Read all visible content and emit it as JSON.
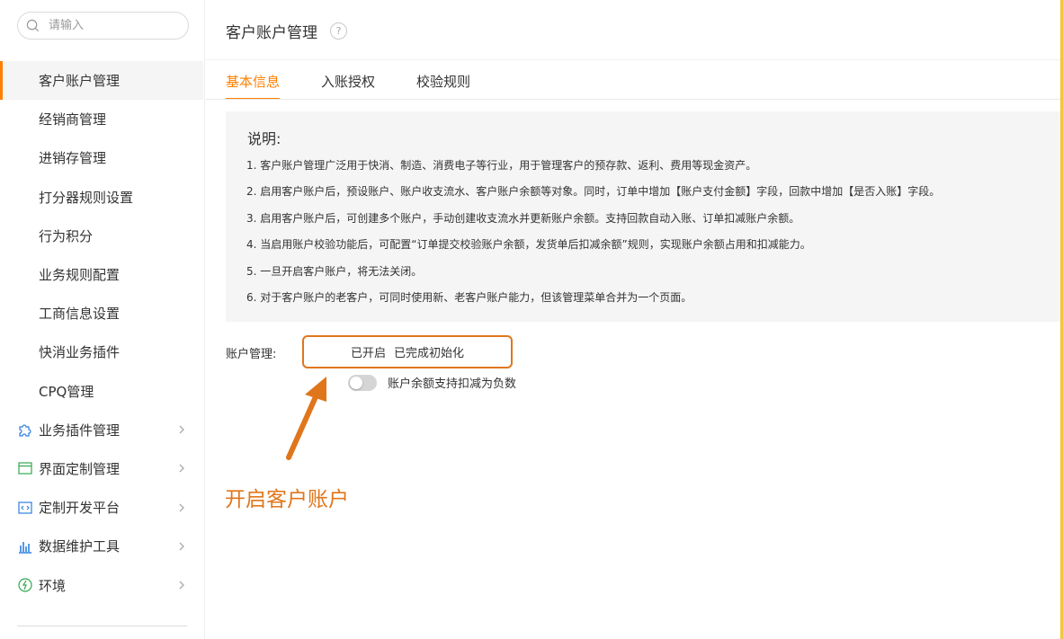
{
  "search": {
    "placeholder": "请输入"
  },
  "sidebar": {
    "items": [
      {
        "label": "客户账户管理",
        "active": true
      },
      {
        "label": "经销商管理"
      },
      {
        "label": "进销存管理"
      },
      {
        "label": "打分器规则设置"
      },
      {
        "label": "行为积分"
      },
      {
        "label": "业务规则配置"
      },
      {
        "label": "工商信息设置"
      },
      {
        "label": "快消业务插件"
      },
      {
        "label": "CPQ管理"
      }
    ],
    "groups": [
      {
        "label": "业务插件管理",
        "icon": "puzzle-icon"
      },
      {
        "label": "界面定制管理",
        "icon": "window-icon"
      },
      {
        "label": "定制开发平台",
        "icon": "code-icon"
      },
      {
        "label": "数据维护工具",
        "icon": "bar-chart-icon"
      },
      {
        "label": "环境",
        "icon": "environment-icon"
      }
    ]
  },
  "header": {
    "title": "客户账户管理",
    "help": "?"
  },
  "tabs": [
    {
      "label": "基本信息",
      "active": true
    },
    {
      "label": "入账授权"
    },
    {
      "label": "校验规则"
    }
  ],
  "notice": {
    "title": "说明:",
    "lines": [
      "1. 客户账户管理广泛用于快消、制造、消费电子等行业，用于管理客户的预存款、返利、费用等现金资产。",
      "2. 启用客户账户后，预设账户、账户收支流水、客户账户余额等对象。同时，订单中增加【账户支付金额】字段，回款中增加【是否入账】字段。",
      "3. 启用客户账户后，可创建多个账户，手动创建收支流水并更新账户余额。支持回款自动入账、订单扣减账户余额。",
      "4. 当启用账户校验功能后，可配置“订单提交校验账户余额，发货单后扣减余额”规则，实现账户余额占用和扣减能力。",
      "5. 一旦开启客户账户，将无法关闭。",
      "6. 对于客户账户的老客户，可同时使用新、老客户账户能力，但该管理菜单合并为一个页面。"
    ]
  },
  "account": {
    "label": "账户管理:",
    "status_enabled": "已开启",
    "status_init": "已完成初始化",
    "toggle_label": "账户余额支持扣减为负数",
    "toggle_on": false
  },
  "annotation": {
    "text": "开启客户账户",
    "color": "#e0761c"
  },
  "colors": {
    "accent": "#ff8000",
    "highlight": "#e0761c",
    "frame": "#f3c737"
  }
}
